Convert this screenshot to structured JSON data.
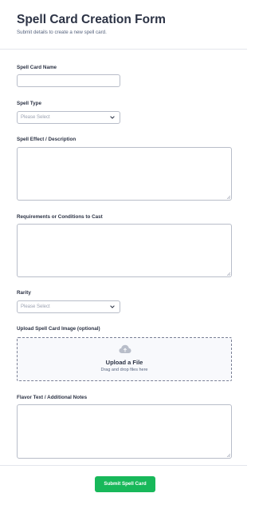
{
  "form": {
    "title": "Spell Card Creation Form",
    "subtitle": "Submit details to create a new spell card."
  },
  "fields": {
    "name": {
      "label": "Spell Card Name",
      "value": ""
    },
    "type": {
      "label": "Spell Type",
      "selected": "Please Select"
    },
    "effect": {
      "label": "Spell Effect / Description",
      "value": ""
    },
    "requirements": {
      "label": "Requirements or Conditions to Cast",
      "value": ""
    },
    "rarity": {
      "label": "Rarity",
      "selected": "Please Select"
    },
    "image": {
      "label": "Upload Spell Card Image (optional)",
      "upload_title": "Upload a File",
      "upload_hint": "Drag and drop files here"
    },
    "flavor": {
      "label": "Flavor Text / Additional Notes",
      "value": ""
    }
  },
  "submit": {
    "label": "Submit Spell Card"
  },
  "colors": {
    "accent": "#18b85a",
    "text": "#2c3345",
    "border": "#b8bdc9",
    "upload_bg": "#f8f9fc"
  },
  "icons": [
    "chevron-down-icon",
    "cloud-upload-icon",
    "resize-handle-icon"
  ]
}
